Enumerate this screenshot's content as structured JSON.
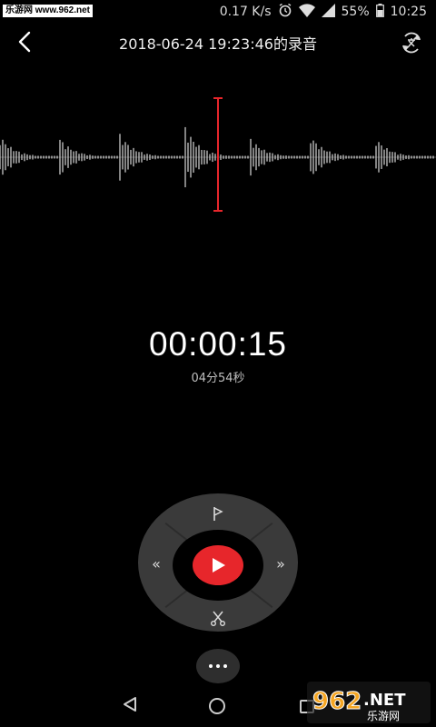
{
  "status_bar": {
    "watermark": "乐游网 www.962.net",
    "speed": "0.17 K/s",
    "battery": "55%",
    "time": "10:25"
  },
  "header": {
    "title": "2018-06-24 19:23:46的录音",
    "back_icon": "back-arrow-icon",
    "translate_icon": "translate-icon"
  },
  "player": {
    "elapsed": "00:00:15",
    "total": "04分54秒",
    "accent_color": "#e7262b"
  },
  "controls": {
    "flag_icon": "flag-icon",
    "rewind_label": "«",
    "play_icon": "play-icon",
    "forward_label": "»",
    "cut_icon": "scissors-icon",
    "more_icon": "more-icon"
  },
  "navbar": {
    "back_icon": "triangle-back-icon",
    "home_icon": "circle-home-icon",
    "recent_icon": "square-recent-icon"
  },
  "logo": {
    "text": "962.NET",
    "subtext": "乐游网"
  }
}
